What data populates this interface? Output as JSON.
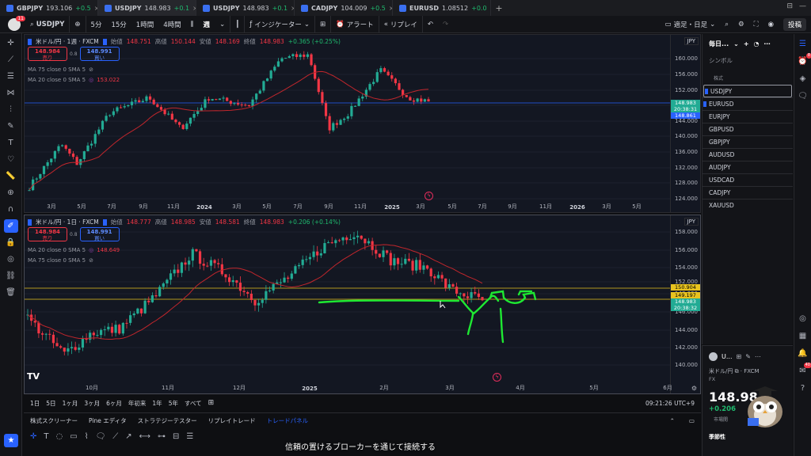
{
  "browser_tabs": [
    {
      "symbol": "GBPJPY",
      "price": "193.106",
      "change": "+0.5"
    },
    {
      "symbol": "USDJPY",
      "price": "148.983",
      "change": "+0.1",
      "active": true
    },
    {
      "symbol": "USDJPY",
      "price": "148.983",
      "change": "+0.1"
    },
    {
      "symbol": "CADJPY",
      "price": "104.009",
      "change": "+0.5"
    },
    {
      "symbol": "EURUSD",
      "price": "1.08512",
      "change": "+0.0"
    }
  ],
  "toolbar": {
    "avatar_badge": "11",
    "symbol": "USDJPY",
    "intervals": [
      "5分",
      "15分",
      "1時間",
      "4時間"
    ],
    "active_interval": "週",
    "indicators": "インジケーター",
    "alert": "アラート",
    "replay": "リプレイ",
    "layout": "適足・日足",
    "publish": "投稿"
  },
  "pane1": {
    "title": "米ドル/円 · 1週 · FXCM",
    "ohlc": {
      "open_label": "始値",
      "open": "148.751",
      "high_label": "高値",
      "high": "150.144",
      "low_label": "安値",
      "low": "148.169",
      "close_label": "終値",
      "close": "148.983",
      "change": "+0.365 (+0.25%)"
    },
    "sell": {
      "price": "148.984",
      "label": "売り"
    },
    "buy": {
      "price": "148.991",
      "label": "買い"
    },
    "spread": "0.8",
    "ind1": {
      "label": "MA 75 close 0 SMA 5",
      "value": ""
    },
    "ind2": {
      "label": "MA 20 close 0 SMA 5",
      "value": "153.022"
    },
    "currency": "JPY",
    "price_ticks": [
      "160.000",
      "156.000",
      "152.000",
      "148.000",
      "144.000",
      "140.000",
      "136.000",
      "132.000",
      "128.000",
      "124.000"
    ],
    "tags": [
      {
        "text": "148.983",
        "sub": "20:38:31",
        "color": "#22ab94"
      },
      {
        "text": "148.861",
        "sub": "",
        "color": "#2962ff"
      }
    ],
    "time_ticks": [
      "3月",
      "5月",
      "7月",
      "9月",
      "11月",
      "2024",
      "3月",
      "5月",
      "7月",
      "9月",
      "11月",
      "2025",
      "3月",
      "5月",
      "7月",
      "9月",
      "11月",
      "2026",
      "3月",
      "5月"
    ]
  },
  "pane2": {
    "title": "米ドル/円 · 1日 · FXCM",
    "ohlc": {
      "open_label": "始値",
      "open": "148.777",
      "high_label": "高値",
      "high": "148.985",
      "low_label": "安値",
      "low": "148.581",
      "close_label": "終値",
      "close": "148.983",
      "change": "+0.206 (+0.14%)"
    },
    "sell": {
      "price": "148.984",
      "label": "売り"
    },
    "buy": {
      "price": "148.991",
      "label": "買い"
    },
    "spread": "0.8",
    "ind1": {
      "label": "MA 20 close 0 SMA 5",
      "value": "148.649"
    },
    "ind2": {
      "label": "MA 75 close 0 SMA 5",
      "value": ""
    },
    "currency": "JPY",
    "price_ticks": [
      "158.000",
      "156.000",
      "154.000",
      "152.000",
      "148.000",
      "146.000",
      "144.000",
      "142.000",
      "140.000"
    ],
    "tags": [
      {
        "text": "150.904",
        "sub": "",
        "color": "#e8c31f"
      },
      {
        "text": "149.197",
        "sub": "",
        "color": "#e8c31f"
      },
      {
        "text": "148.983",
        "sub": "20:38:32",
        "color": "#22ab94"
      }
    ],
    "time_ticks": [
      "10月",
      "11月",
      "12月",
      "2025",
      "2月",
      "3月",
      "4月",
      "5月",
      "6月"
    ]
  },
  "range_bar": {
    "ranges": [
      "1日",
      "5日",
      "1ヶ月",
      "3ヶ月",
      "6ヶ月",
      "年初来",
      "1年",
      "5年",
      "すべて"
    ],
    "clock": "09:21:26 UTC+9"
  },
  "bottom_tabs": [
    "株式スクリーナー",
    "Pine エディタ",
    "ストラテジーテスター",
    "リプレイトレード",
    "トレードパネル"
  ],
  "subtitle": "信頼の置けるブローカーを通じて接続する",
  "watchlist": {
    "title": "毎日...",
    "symbol_header": "シンボル",
    "section": "株式",
    "items": [
      "USDJPY",
      "EURUSD",
      "EURJPY",
      "GBPUSD",
      "GBPJPY",
      "AUDUSD",
      "AUDJPY",
      "USDCAD",
      "CADJPY",
      "XAUUSD"
    ]
  },
  "detail": {
    "symbol": "U...",
    "name": "米ドル/円",
    "broker": "FXCM",
    "type": "FX",
    "price": "148.98",
    "change": "+0.206",
    "market": "市場開",
    "seasonal": "季節性"
  },
  "right_badges": {
    "alerts": "8",
    "chat": "40"
  },
  "colors": {
    "up": "#22ab94",
    "down": "#f23645",
    "ma": "#c0262c",
    "accent": "#2962ff",
    "annotation": "#1ee832",
    "level": "#e8c31f"
  }
}
